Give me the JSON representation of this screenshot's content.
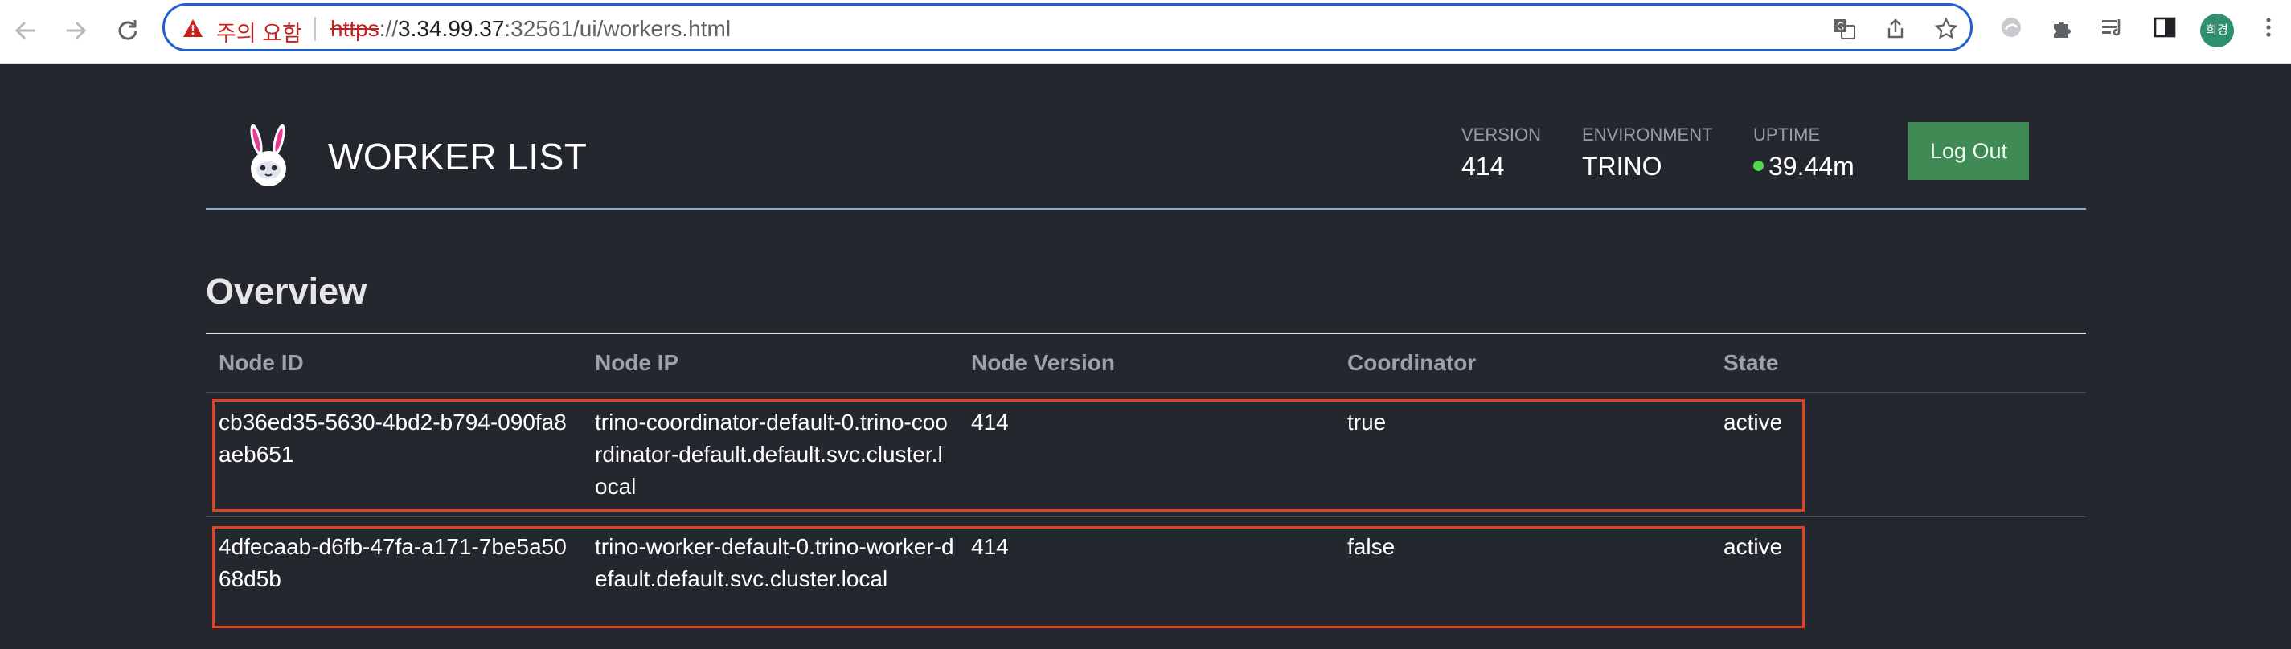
{
  "browser": {
    "security_warning": "주의 요함",
    "url_scheme": "https",
    "url_sep": "://",
    "url_host": "3.34.99.37",
    "url_rest": ":32561/ui/workers.html",
    "profile_initials": "희경"
  },
  "header": {
    "title": "WORKER LIST",
    "stats": [
      {
        "label": "VERSION",
        "value": "414"
      },
      {
        "label": "ENVIRONMENT",
        "value": "TRINO"
      },
      {
        "label": "UPTIME",
        "value": "39.44m"
      }
    ],
    "logout_label": "Log Out",
    "uptime_status_color": "#4fd94f"
  },
  "overview": {
    "title": "Overview",
    "columns": [
      "Node ID",
      "Node IP",
      "Node Version",
      "Coordinator",
      "State"
    ],
    "rows": [
      {
        "node_id": "cb36ed35-5630-4bd2-b794-090fa8aeb651",
        "node_ip": "trino-coordinator-default-0.trino-coordinator-default.default.svc.cluster.local",
        "node_version": "414",
        "coordinator": "true",
        "state": "active"
      },
      {
        "node_id": "4dfecaab-d6fb-47fa-a171-7be5a5068d5b",
        "node_ip": "trino-worker-default-0.trino-worker-default.default.svc.cluster.local",
        "node_version": "414",
        "coordinator": "false",
        "state": "active"
      }
    ]
  },
  "colors": {
    "background": "#25272e",
    "accent_rule": "#79b7d8",
    "logout_button": "#3f8a55",
    "highlight_box": "#e0431e"
  }
}
